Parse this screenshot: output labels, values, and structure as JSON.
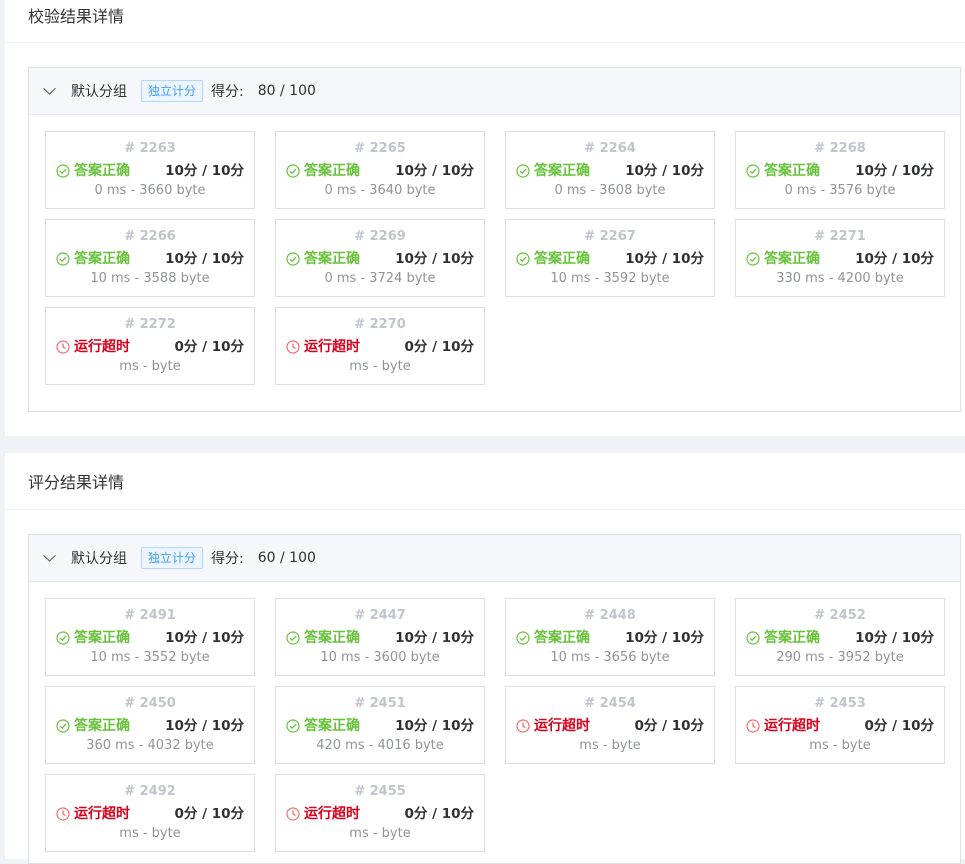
{
  "sections": [
    {
      "title": "校验结果详情",
      "group": {
        "name": "默认分组",
        "tag": "独立计分",
        "score_label": "得分:",
        "score": "80 / 100"
      },
      "cases": [
        {
          "id": "# 2263",
          "status": "答案正确",
          "ok": true,
          "points": "10分 / 10分",
          "meta": "0 ms - 3660 byte"
        },
        {
          "id": "# 2265",
          "status": "答案正确",
          "ok": true,
          "points": "10分 / 10分",
          "meta": "0 ms - 3640 byte"
        },
        {
          "id": "# 2264",
          "status": "答案正确",
          "ok": true,
          "points": "10分 / 10分",
          "meta": "0 ms - 3608 byte"
        },
        {
          "id": "# 2268",
          "status": "答案正确",
          "ok": true,
          "points": "10分 / 10分",
          "meta": "0 ms - 3576 byte"
        },
        {
          "id": "# 2266",
          "status": "答案正确",
          "ok": true,
          "points": "10分 / 10分",
          "meta": "10 ms - 3588 byte"
        },
        {
          "id": "# 2269",
          "status": "答案正确",
          "ok": true,
          "points": "10分 / 10分",
          "meta": "0 ms - 3724 byte"
        },
        {
          "id": "# 2267",
          "status": "答案正确",
          "ok": true,
          "points": "10分 / 10分",
          "meta": "10 ms - 3592 byte"
        },
        {
          "id": "# 2271",
          "status": "答案正确",
          "ok": true,
          "points": "10分 / 10分",
          "meta": "330 ms - 4200 byte"
        },
        {
          "id": "# 2272",
          "status": "运行超时",
          "ok": false,
          "points": "0分 / 10分",
          "meta": "ms - byte"
        },
        {
          "id": "# 2270",
          "status": "运行超时",
          "ok": false,
          "points": "0分 / 10分",
          "meta": "ms - byte"
        }
      ]
    },
    {
      "title": "评分结果详情",
      "group": {
        "name": "默认分组",
        "tag": "独立计分",
        "score_label": "得分:",
        "score": "60 / 100"
      },
      "cases": [
        {
          "id": "# 2491",
          "status": "答案正确",
          "ok": true,
          "points": "10分 / 10分",
          "meta": "10 ms - 3552 byte"
        },
        {
          "id": "# 2447",
          "status": "答案正确",
          "ok": true,
          "points": "10分 / 10分",
          "meta": "10 ms - 3600 byte"
        },
        {
          "id": "# 2448",
          "status": "答案正确",
          "ok": true,
          "points": "10分 / 10分",
          "meta": "10 ms - 3656 byte"
        },
        {
          "id": "# 2452",
          "status": "答案正确",
          "ok": true,
          "points": "10分 / 10分",
          "meta": "290 ms - 3952 byte"
        },
        {
          "id": "# 2450",
          "status": "答案正确",
          "ok": true,
          "points": "10分 / 10分",
          "meta": "360 ms - 4032 byte"
        },
        {
          "id": "# 2451",
          "status": "答案正确",
          "ok": true,
          "points": "10分 / 10分",
          "meta": "420 ms - 4016 byte"
        },
        {
          "id": "# 2454",
          "status": "运行超时",
          "ok": false,
          "points": "0分 / 10分",
          "meta": "ms - byte"
        },
        {
          "id": "# 2453",
          "status": "运行超时",
          "ok": false,
          "points": "0分 / 10分",
          "meta": "ms - byte"
        },
        {
          "id": "# 2492",
          "status": "运行超时",
          "ok": false,
          "points": "0分 / 10分",
          "meta": "ms - byte"
        },
        {
          "id": "# 2455",
          "status": "运行超时",
          "ok": false,
          "points": "0分 / 10分",
          "meta": "ms - byte"
        }
      ]
    }
  ],
  "colors": {
    "ok": "#67c23a",
    "tle": "#d9001b",
    "tag": "#409eff"
  },
  "icons": {
    "ok": "check-circle-icon",
    "tle": "clock-icon",
    "collapse": "chevron-down-icon"
  }
}
